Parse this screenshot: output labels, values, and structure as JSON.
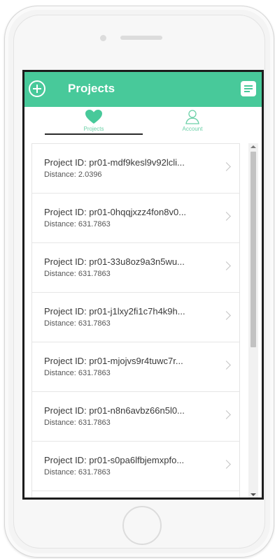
{
  "header": {
    "title": "Projects",
    "accent_color": "#48c99a",
    "left_icon": "add-circle-icon",
    "right_icon": "menu-icon"
  },
  "tabs": [
    {
      "label": "Projects",
      "icon": "heart-icon",
      "active": true
    },
    {
      "label": "Account",
      "icon": "user-icon",
      "active": false
    }
  ],
  "projects": [
    {
      "title": "Project ID: pr01-mdf9kesl9v92lcli...",
      "distance": "Distance: 2.0396"
    },
    {
      "title": "Project ID: pr01-0hqqjxzz4fon8v0...",
      "distance": "Distance: 631.7863"
    },
    {
      "title": "Project ID: pr01-33u8oz9a3n5wu...",
      "distance": "Distance: 631.7863"
    },
    {
      "title": "Project ID: pr01-j1lxy2fi1c7h4k9h...",
      "distance": "Distance: 631.7863"
    },
    {
      "title": "Project ID: pr01-mjojvs9r4tuwc7r...",
      "distance": "Distance: 631.7863"
    },
    {
      "title": "Project ID: pr01-n8n6avbz66n5l0...",
      "distance": "Distance: 631.7863"
    },
    {
      "title": "Project ID: pr01-s0pa6lfbjemxpfo...",
      "distance": "Distance: 631.7863"
    },
    {
      "title": "",
      "distance": ""
    }
  ]
}
